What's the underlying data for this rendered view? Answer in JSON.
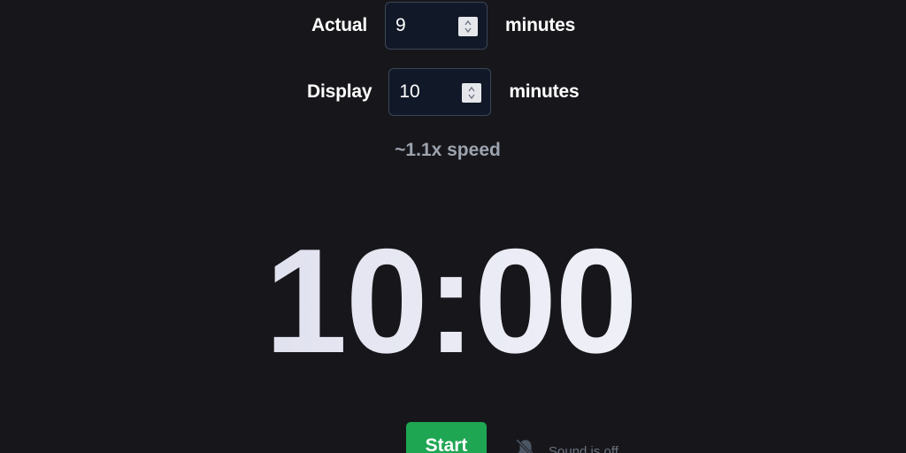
{
  "settings": {
    "actual": {
      "label": "Actual",
      "value": "9",
      "unit": "minutes"
    },
    "display": {
      "label": "Display",
      "value": "10",
      "unit": "minutes"
    },
    "speed_text": "~1.1x speed"
  },
  "timer": {
    "time": "10:00"
  },
  "controls": {
    "start_label": "Start",
    "sound_label": "Sound is off",
    "sound_icon": "bell-off-icon"
  },
  "colors": {
    "background": "#17171b",
    "start_button": "#1fa653",
    "muted_text": "#9ca3af"
  }
}
